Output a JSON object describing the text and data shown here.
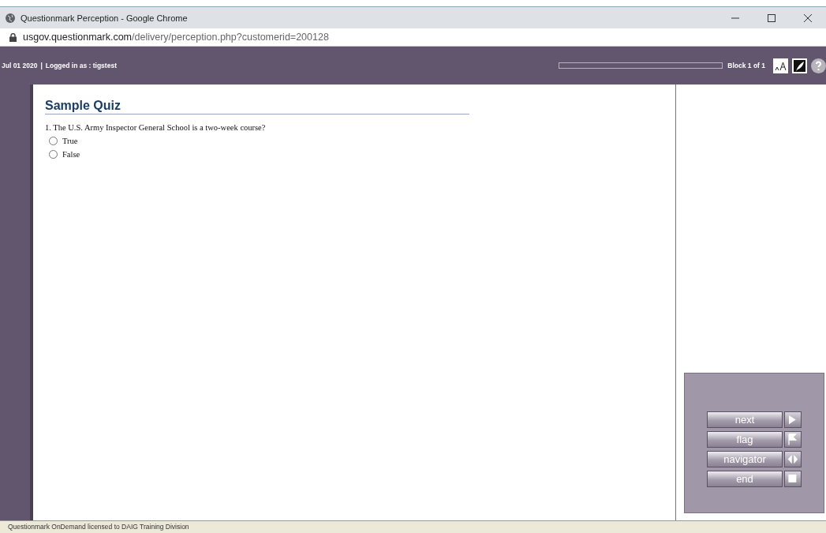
{
  "window": {
    "title": "Questionmark Perception - Google Chrome",
    "url_host": "usgov.questionmark.com",
    "url_path": "/delivery/perception.php?customerid=200128"
  },
  "header": {
    "date": "Jul 01 2020",
    "separator": "|",
    "login": "Logged in as : tigstest",
    "progress": {
      "level": 0
    },
    "block": "Block 1 of 1"
  },
  "quiz": {
    "title": "Sample Quiz",
    "question": "1. The U.S. Army Inspector General School is a two-week course?",
    "options": [
      {
        "label": "True",
        "selected": false
      },
      {
        "label": "False",
        "selected": false
      }
    ]
  },
  "nav_buttons": [
    {
      "label": "next",
      "kind": "next"
    },
    {
      "label": "flag",
      "kind": "flag"
    },
    {
      "label": "navigator",
      "kind": "navigator"
    },
    {
      "label": "end",
      "kind": "end"
    }
  ],
  "footer": "Questionmark OnDemand licensed to DAIG Training Division"
}
